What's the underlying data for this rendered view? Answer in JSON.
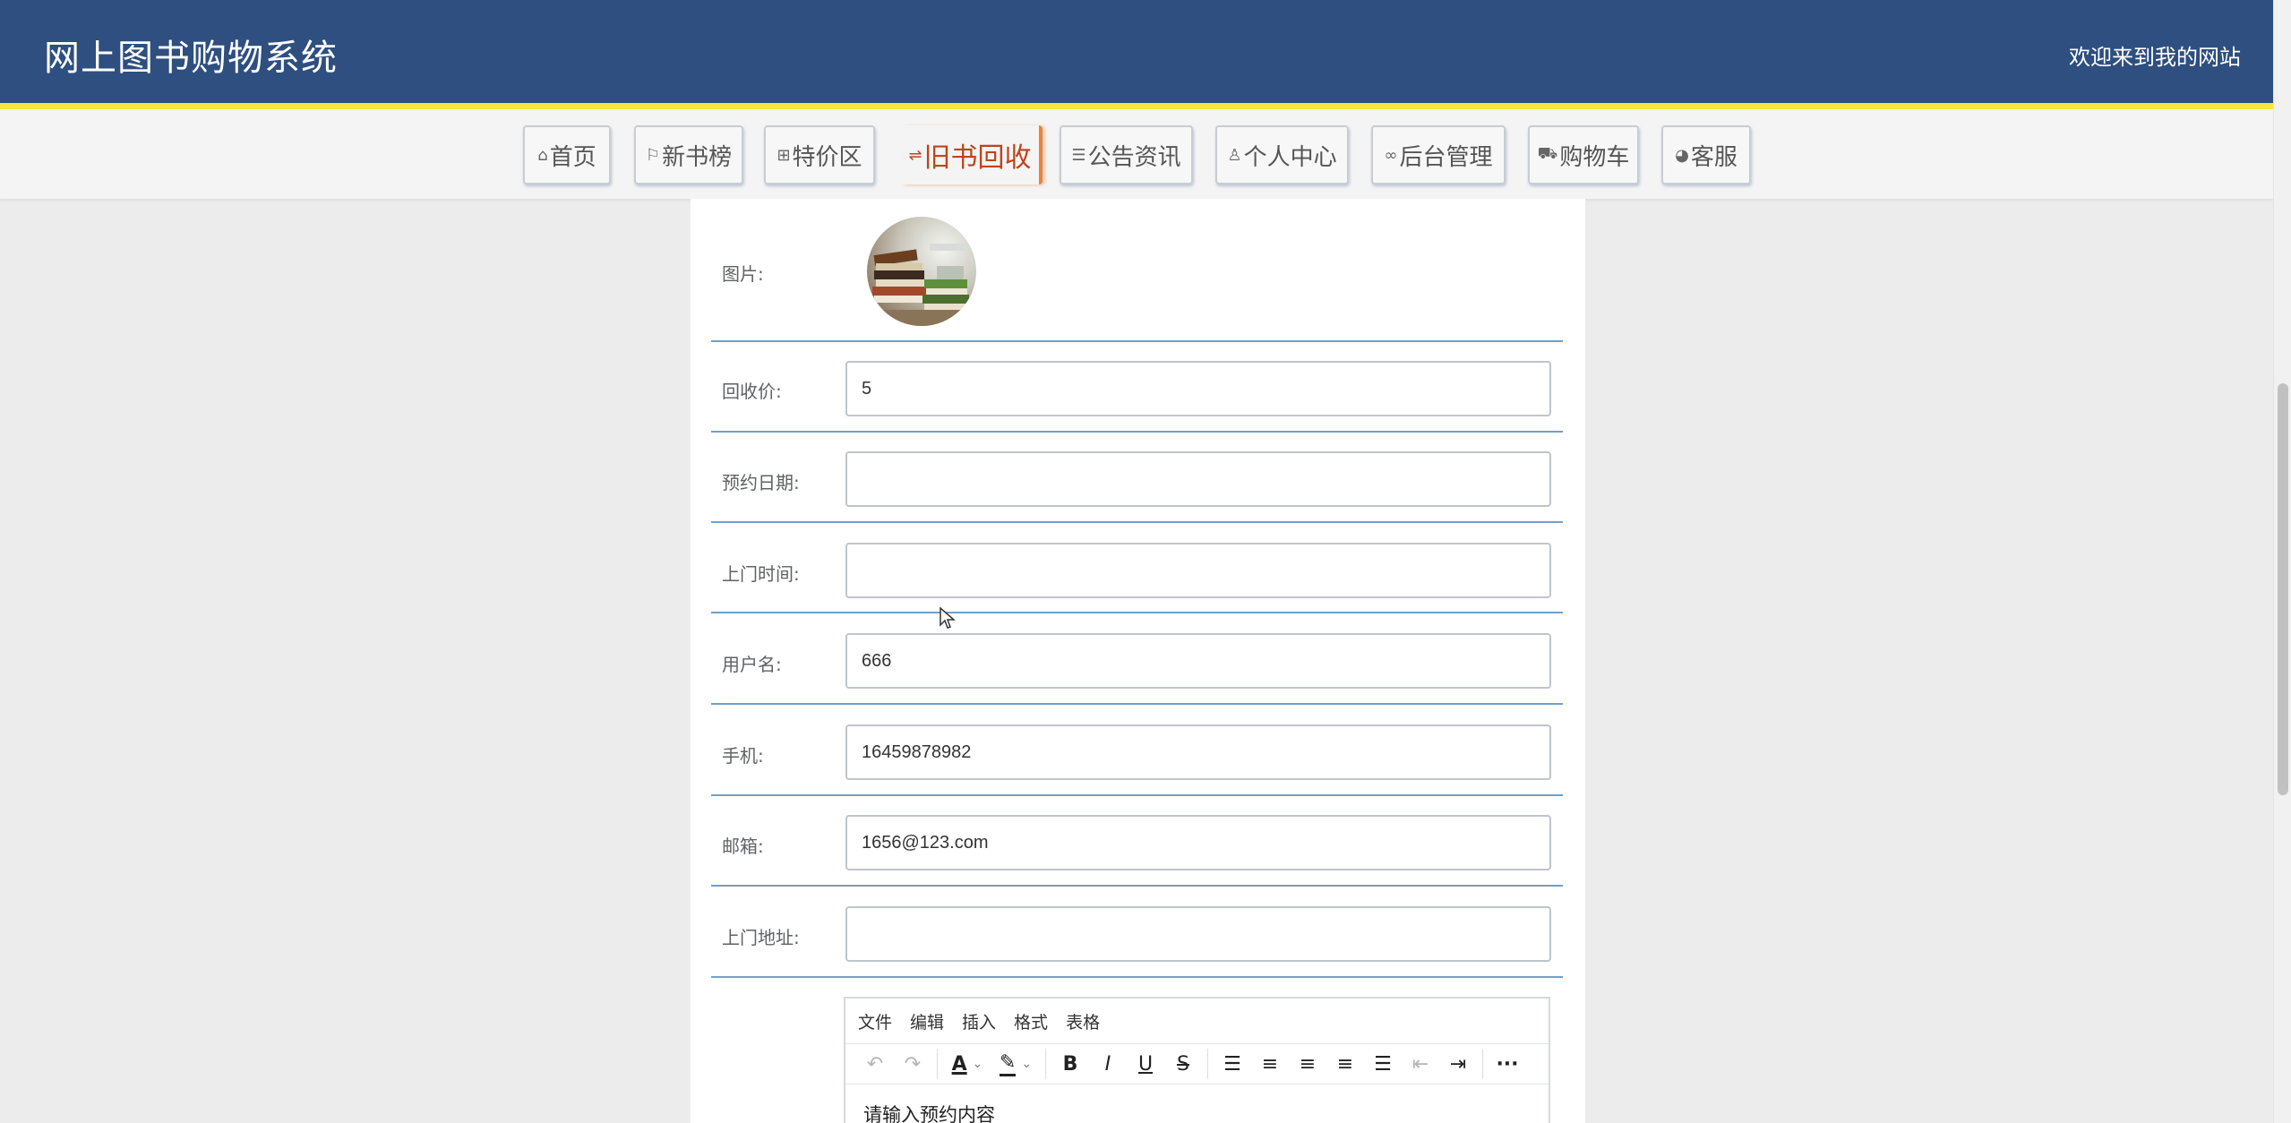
{
  "header": {
    "title": "网上图书购物系统",
    "welcome": "欢迎来到我的网站"
  },
  "nav": {
    "items": [
      {
        "label": "首页",
        "icon": "home-icon",
        "glyph": "⌂"
      },
      {
        "label": "新书榜",
        "icon": "flag-icon",
        "glyph": "⚐"
      },
      {
        "label": "特价区",
        "icon": "grid-icon",
        "glyph": "⊞"
      },
      {
        "label": "旧书回收",
        "icon": "sliders-icon",
        "glyph": "⇌",
        "active": true
      },
      {
        "label": "公告资讯",
        "icon": "layers-icon",
        "glyph": "☰"
      },
      {
        "label": "个人中心",
        "icon": "user-icon",
        "glyph": "♙"
      },
      {
        "label": "后台管理",
        "icon": "link-icon",
        "glyph": "∞"
      },
      {
        "label": "购物车",
        "icon": "cart-icon",
        "glyph": "⛟"
      },
      {
        "label": "客服",
        "icon": "chat-icon",
        "glyph": "◕"
      }
    ]
  },
  "form": {
    "image_label": "图片:",
    "price_label": "回收价:",
    "price_value": "5",
    "date_label": "预约日期:",
    "date_value": "",
    "time_label": "上门时间:",
    "time_value": "",
    "username_label": "用户名:",
    "username_value": "666",
    "phone_label": "手机:",
    "phone_value": "16459878982",
    "email_label": "邮箱:",
    "email_value": "1656@123.com",
    "address_label": "上门地址:",
    "address_value": ""
  },
  "editor": {
    "menu": [
      "文件",
      "编辑",
      "插入",
      "格式",
      "表格"
    ],
    "placeholder": "请输入预约内容"
  },
  "colors": {
    "header_bg": "#2e4f7f",
    "header_accent": "#f4e63a",
    "active_nav": "#c0431b",
    "row_divider": "#6fa0c9"
  }
}
